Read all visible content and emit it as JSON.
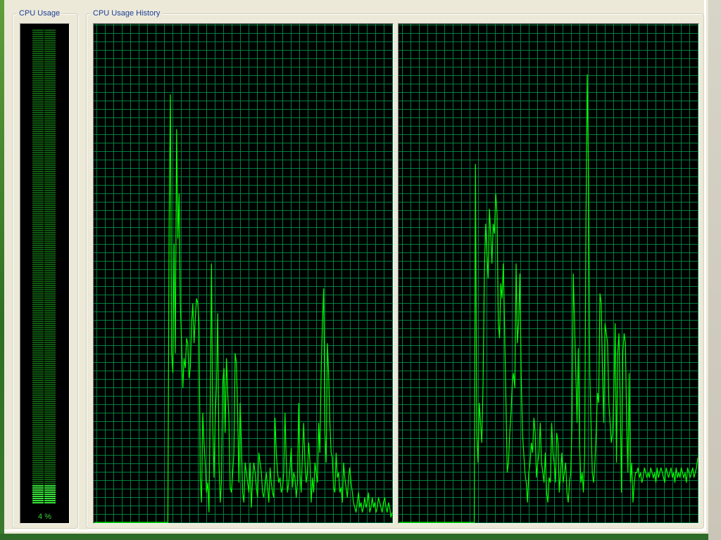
{
  "cpu_usage": {
    "title": "CPU Usage",
    "readout": "4 %",
    "percent": 4
  },
  "cpu_history": {
    "title": "CPU Usage History",
    "colors": {
      "grid": "#007f3f",
      "line": "#00ff00",
      "background": "#000000"
    },
    "cores": [
      {
        "values": [
          0,
          0,
          0,
          0,
          0,
          0,
          0,
          0,
          0,
          0,
          0,
          0,
          0,
          0,
          0,
          0,
          0,
          0,
          0,
          0,
          0,
          0,
          0,
          0,
          0,
          0,
          0,
          0,
          0,
          0,
          0,
          0,
          0,
          0,
          0,
          0,
          0,
          0,
          0,
          0,
          0,
          0,
          0,
          0,
          0,
          0,
          0,
          0,
          0,
          0,
          0,
          0,
          0,
          0,
          0,
          0,
          0,
          0,
          0,
          0,
          60,
          86,
          34,
          30,
          56,
          34,
          79,
          57,
          66,
          44,
          36,
          27,
          33,
          31,
          37,
          36,
          29,
          31,
          40,
          44,
          36,
          41,
          45,
          44,
          40,
          9,
          4,
          22,
          16,
          12,
          6,
          8,
          2,
          24,
          52,
          20,
          9,
          21,
          27,
          42,
          12,
          4,
          8,
          28,
          31,
          18,
          33,
          26,
          21,
          7,
          6,
          10,
          14,
          34,
          32,
          22,
          8,
          24,
          16,
          6,
          4,
          12,
          10,
          8,
          6,
          12,
          3,
          9,
          12,
          10,
          7,
          5,
          14,
          12,
          10,
          6,
          5,
          8,
          10,
          7,
          4,
          11,
          8,
          6,
          5,
          21,
          14,
          10,
          8,
          9,
          6,
          7,
          10,
          22,
          12,
          6,
          8,
          11,
          15,
          7,
          10,
          9,
          5,
          8,
          24,
          10,
          6,
          14,
          20,
          12,
          8,
          10,
          16,
          12,
          4,
          9,
          6,
          12,
          10,
          8,
          20,
          14,
          30,
          40,
          47,
          18,
          12,
          36,
          30,
          20,
          14,
          13,
          7,
          6,
          14,
          9,
          10,
          6,
          7,
          4,
          12,
          9,
          7,
          5,
          9,
          11,
          8,
          6,
          4,
          3,
          2,
          4,
          6,
          3,
          4,
          2,
          3,
          5,
          3,
          4,
          6,
          2,
          3,
          5,
          3,
          4,
          2,
          3,
          5,
          4,
          3,
          2,
          4,
          5,
          3,
          2,
          4,
          3,
          1,
          2
        ]
      },
      {
        "values": [
          0,
          0,
          0,
          0,
          0,
          0,
          0,
          0,
          0,
          0,
          0,
          0,
          0,
          0,
          0,
          0,
          0,
          0,
          0,
          0,
          0,
          0,
          0,
          0,
          0,
          0,
          0,
          0,
          0,
          0,
          0,
          0,
          0,
          0,
          0,
          0,
          0,
          0,
          0,
          0,
          0,
          0,
          0,
          0,
          0,
          0,
          0,
          0,
          0,
          0,
          0,
          0,
          0,
          0,
          0,
          0,
          0,
          0,
          0,
          0,
          72,
          18,
          12,
          24,
          20,
          16,
          28,
          50,
          60,
          54,
          49,
          63,
          58,
          52,
          60,
          58,
          66,
          62,
          40,
          37,
          48,
          45,
          52,
          38,
          24,
          10,
          12,
          18,
          22,
          28,
          30,
          27,
          52,
          36,
          40,
          50,
          30,
          18,
          14,
          10,
          8,
          4,
          10,
          12,
          16,
          14,
          21,
          18,
          9,
          12,
          14,
          20,
          12,
          10,
          8,
          14,
          6,
          4,
          9,
          8,
          20,
          14,
          12,
          8,
          18,
          16,
          6,
          10,
          14,
          8,
          10,
          12,
          6,
          4,
          8,
          10,
          20,
          50,
          40,
          30,
          20,
          35,
          15,
          8,
          10,
          6,
          14,
          60,
          90,
          70,
          30,
          20,
          10,
          8,
          12,
          18,
          26,
          24,
          46,
          44,
          30,
          20,
          40,
          38,
          36,
          24,
          20,
          16,
          18,
          26,
          40,
          12,
          34,
          38,
          24,
          6,
          34,
          38,
          36,
          20,
          10,
          30,
          8,
          12,
          4,
          8,
          10,
          10,
          11,
          9,
          10,
          8,
          9,
          11,
          10,
          9,
          10,
          9,
          11,
          10,
          9,
          10,
          8,
          11,
          9,
          10,
          11,
          10,
          9,
          8,
          11,
          10,
          9,
          10,
          11,
          9,
          10,
          8,
          11,
          9,
          10,
          9,
          11,
          10,
          9,
          10,
          8,
          11,
          10,
          9,
          10,
          11,
          9,
          10,
          11,
          13
        ]
      }
    ]
  }
}
